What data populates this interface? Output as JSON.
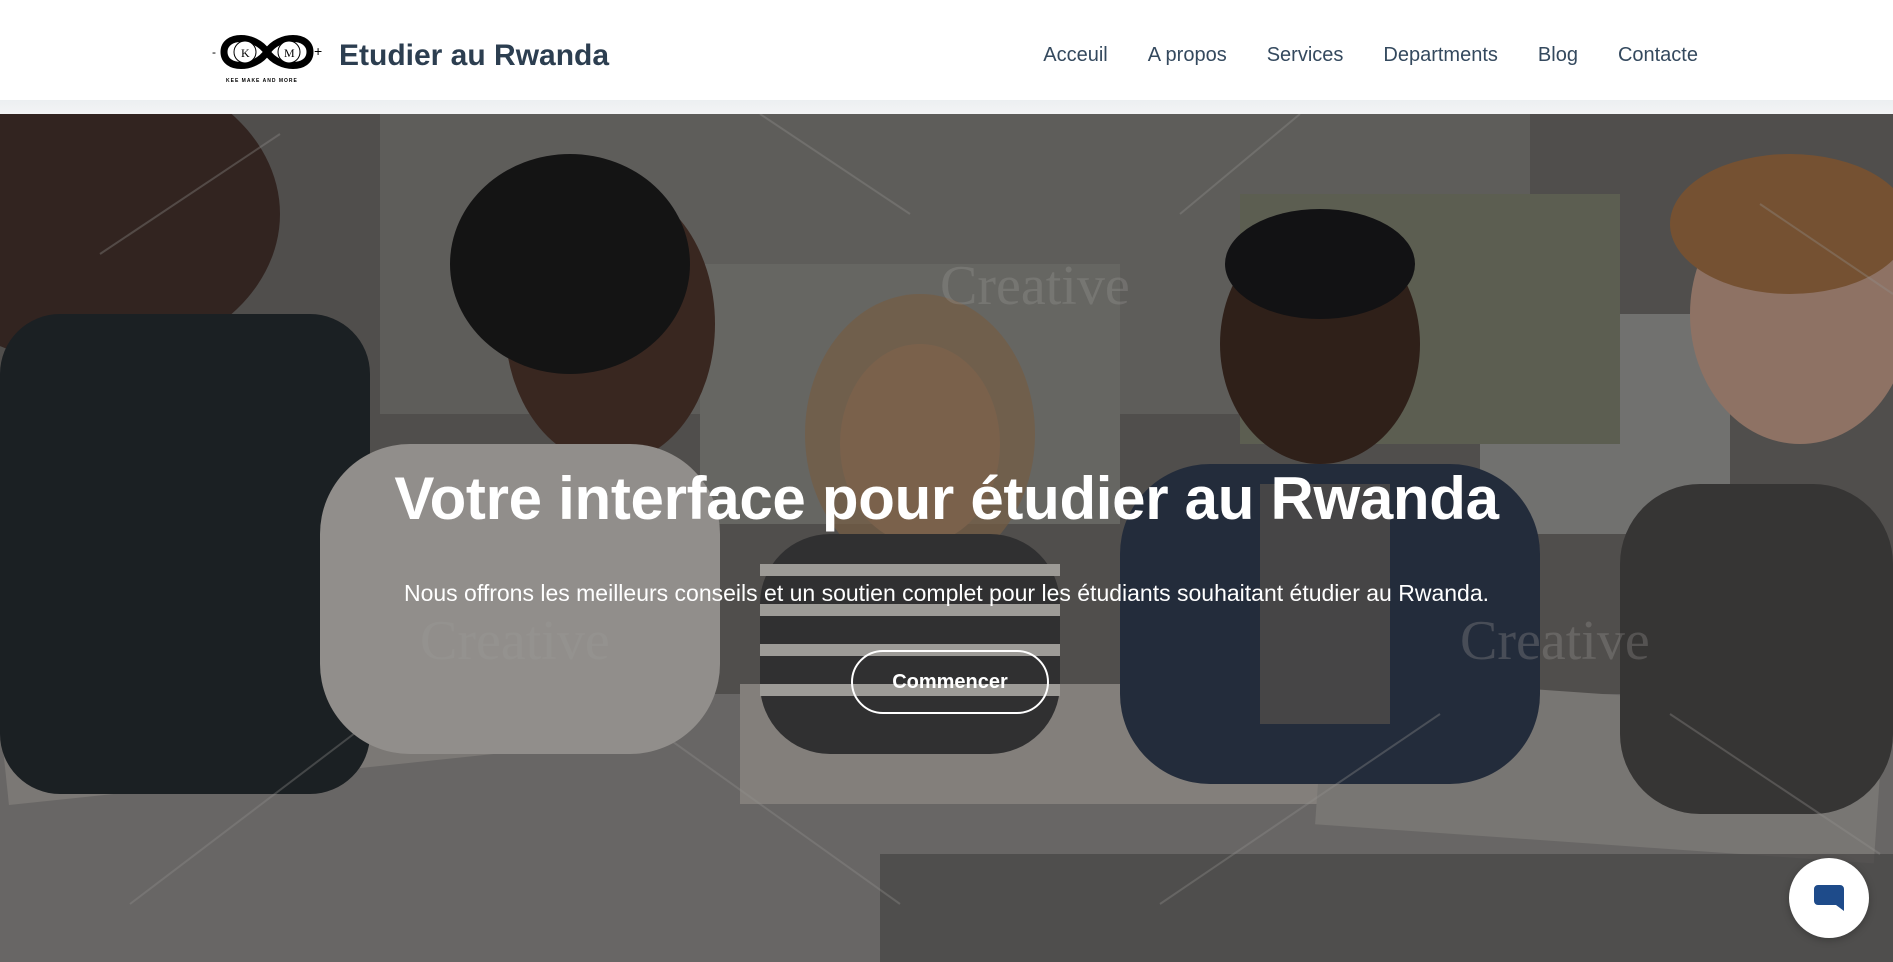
{
  "header": {
    "brand_name": "Etudier au Rwanda",
    "logo": {
      "letters_left": "K",
      "letters_right": "M",
      "sign_left": "-",
      "sign_right": "+",
      "tagline": "KEE MAKE AND MORE"
    },
    "nav": [
      {
        "label": "Acceuil"
      },
      {
        "label": "A propos"
      },
      {
        "label": "Services"
      },
      {
        "label": "Departments"
      },
      {
        "label": "Blog"
      },
      {
        "label": "Contacte"
      }
    ]
  },
  "hero": {
    "title": "Votre interface pour étudier au Rwanda",
    "subtitle": "Nous offrons les meilleurs conseils et un soutien complet pour les étudiants souhaitant étudier au Rwanda.",
    "cta_label": "Commencer",
    "image_description_icon": "students-studying-photo",
    "watermark_text": "Creative"
  },
  "chat_widget": {
    "icon": "chat-bubble-icon",
    "color": "#1e4b8a"
  },
  "colors": {
    "brand_text": "#2c3e50",
    "nav_text": "#34495e",
    "hero_text": "#ffffff"
  }
}
